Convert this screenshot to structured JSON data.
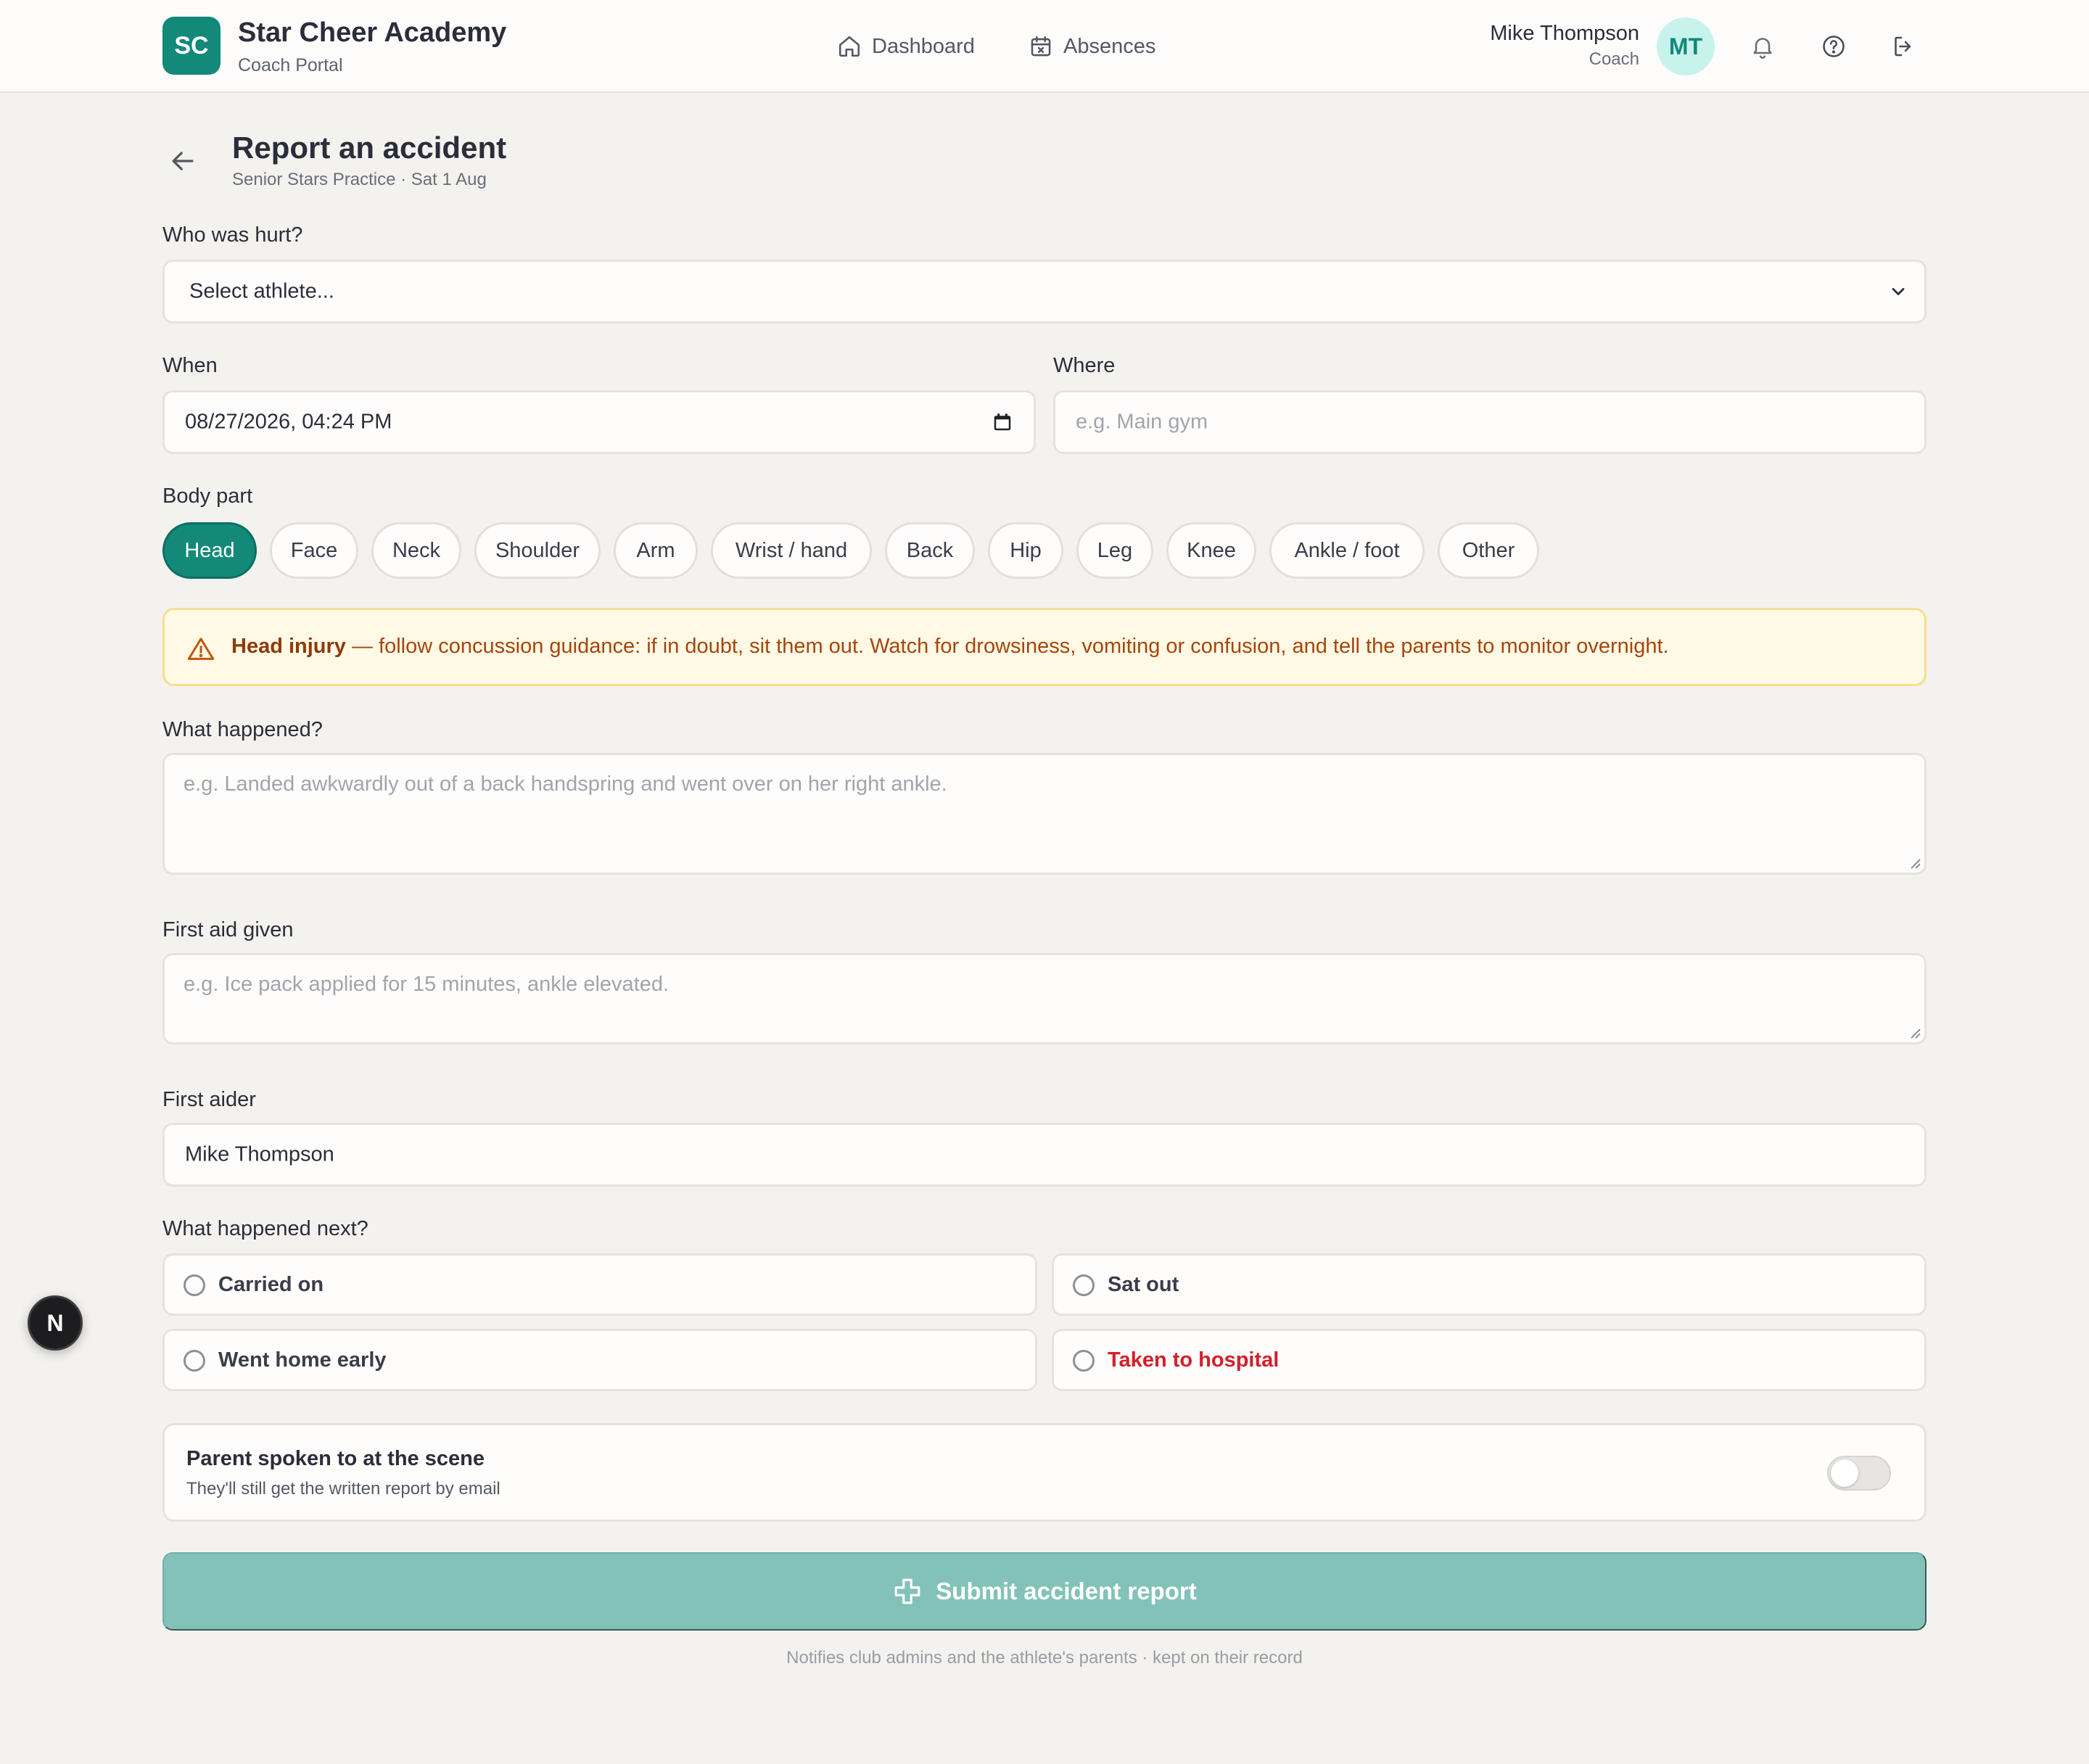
{
  "app": {
    "logo_initials": "SC",
    "name": "Star Cheer Academy",
    "subtitle": "Coach Portal"
  },
  "nav": {
    "dashboard": "Dashboard",
    "absences": "Absences"
  },
  "user": {
    "name": "Mike Thompson",
    "role": "Coach",
    "initials": "MT"
  },
  "page": {
    "title": "Report an accident",
    "subtitle": "Senior Stars Practice · Sat 1 Aug"
  },
  "form": {
    "who_label": "Who was hurt?",
    "athlete_select": "Select athlete...",
    "when_label": "When",
    "when_value": "08/27/2026, 04:24 PM",
    "where_label": "Where",
    "where_placeholder": "e.g. Main gym",
    "body_part_label": "Body part",
    "body_parts": [
      "Head",
      "Face",
      "Neck",
      "Shoulder",
      "Arm",
      "Wrist / hand",
      "Back",
      "Hip",
      "Leg",
      "Knee",
      "Ankle / foot",
      "Other"
    ],
    "selected_body_part": "Head",
    "alert_title": "Head injury",
    "alert_text": " — follow concussion guidance: if in doubt, sit them out. Watch for drowsiness, vomiting or confusion, and tell the parents to monitor overnight.",
    "what_label": "What happened?",
    "what_placeholder": "e.g. Landed awkwardly out of a back handspring and went over on her right ankle.",
    "firstaid_label": "First aid given",
    "firstaid_placeholder": "e.g. Ice pack applied for 15 minutes, ankle elevated.",
    "firstaider_label": "First aider",
    "firstaider_value": "Mike Thompson",
    "next_label": "What happened next?",
    "next_options": [
      "Carried on",
      "Sat out",
      "Went home early",
      "Taken to hospital"
    ],
    "parent_title": "Parent spoken to at the scene",
    "parent_sub": "They'll still get the written report by email",
    "parent_toggle_on": false,
    "submit_label": "Submit accident report",
    "footnote": "Notifies club admins and the athlete's parents · kept on their record"
  },
  "badge": {
    "letter": "N"
  },
  "colors": {
    "accent": "#13897a",
    "warning_bg": "#fff9e5",
    "warning_text": "#a5460c",
    "danger": "#d21f2b"
  }
}
